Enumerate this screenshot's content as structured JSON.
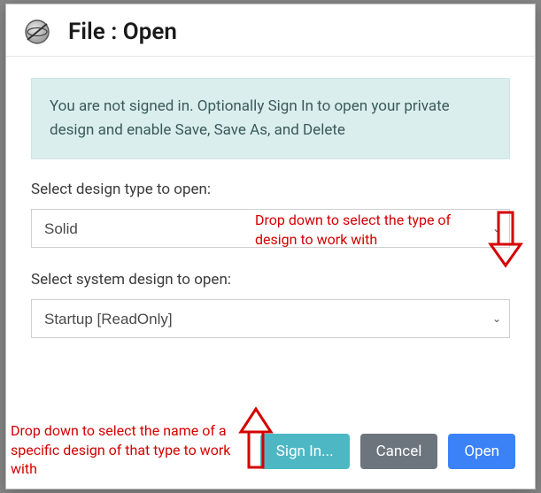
{
  "dialog": {
    "title": "File : Open",
    "info_message": "You are not signed in. Optionally Sign In to open your private design and enable Save, Save As, and Delete"
  },
  "fields": {
    "design_type": {
      "label": "Select design type to open:",
      "value": "Solid",
      "options": [
        "Solid"
      ]
    },
    "system_design": {
      "label": "Select system design to open:",
      "value": "Startup [ReadOnly]",
      "options": [
        "Startup [ReadOnly]"
      ]
    }
  },
  "buttons": {
    "signin": "Sign In...",
    "cancel": "Cancel",
    "open": "Open"
  },
  "annotations": {
    "type_hint": "Drop down to select the type of design to work with",
    "name_hint": "Drop down to select the name of a  specific design of that type to work with"
  },
  "colors": {
    "info_bg": "#dbeeee",
    "btn_teal": "#4db8c4",
    "btn_gray": "#6c757d",
    "btn_blue": "#3b82f6",
    "anno_red": "#d40000"
  }
}
